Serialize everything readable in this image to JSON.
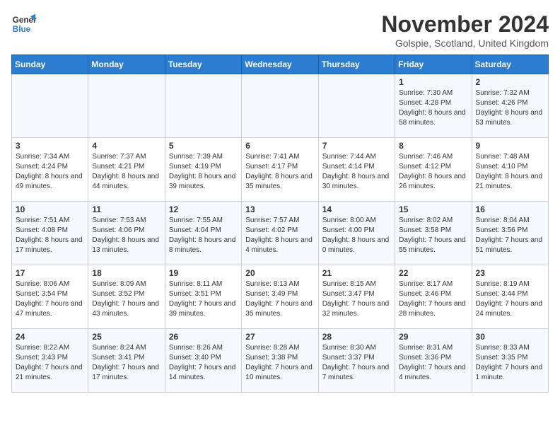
{
  "header": {
    "logo_line1": "General",
    "logo_line2": "Blue",
    "month_year": "November 2024",
    "location": "Golspie, Scotland, United Kingdom"
  },
  "days_of_week": [
    "Sunday",
    "Monday",
    "Tuesday",
    "Wednesday",
    "Thursday",
    "Friday",
    "Saturday"
  ],
  "weeks": [
    [
      {
        "day": "",
        "info": ""
      },
      {
        "day": "",
        "info": ""
      },
      {
        "day": "",
        "info": ""
      },
      {
        "day": "",
        "info": ""
      },
      {
        "day": "",
        "info": ""
      },
      {
        "day": "1",
        "info": "Sunrise: 7:30 AM\nSunset: 4:28 PM\nDaylight: 8 hours and 58 minutes."
      },
      {
        "day": "2",
        "info": "Sunrise: 7:32 AM\nSunset: 4:26 PM\nDaylight: 8 hours and 53 minutes."
      }
    ],
    [
      {
        "day": "3",
        "info": "Sunrise: 7:34 AM\nSunset: 4:24 PM\nDaylight: 8 hours and 49 minutes."
      },
      {
        "day": "4",
        "info": "Sunrise: 7:37 AM\nSunset: 4:21 PM\nDaylight: 8 hours and 44 minutes."
      },
      {
        "day": "5",
        "info": "Sunrise: 7:39 AM\nSunset: 4:19 PM\nDaylight: 8 hours and 39 minutes."
      },
      {
        "day": "6",
        "info": "Sunrise: 7:41 AM\nSunset: 4:17 PM\nDaylight: 8 hours and 35 minutes."
      },
      {
        "day": "7",
        "info": "Sunrise: 7:44 AM\nSunset: 4:14 PM\nDaylight: 8 hours and 30 minutes."
      },
      {
        "day": "8",
        "info": "Sunrise: 7:46 AM\nSunset: 4:12 PM\nDaylight: 8 hours and 26 minutes."
      },
      {
        "day": "9",
        "info": "Sunrise: 7:48 AM\nSunset: 4:10 PM\nDaylight: 8 hours and 21 minutes."
      }
    ],
    [
      {
        "day": "10",
        "info": "Sunrise: 7:51 AM\nSunset: 4:08 PM\nDaylight: 8 hours and 17 minutes."
      },
      {
        "day": "11",
        "info": "Sunrise: 7:53 AM\nSunset: 4:06 PM\nDaylight: 8 hours and 13 minutes."
      },
      {
        "day": "12",
        "info": "Sunrise: 7:55 AM\nSunset: 4:04 PM\nDaylight: 8 hours and 8 minutes."
      },
      {
        "day": "13",
        "info": "Sunrise: 7:57 AM\nSunset: 4:02 PM\nDaylight: 8 hours and 4 minutes."
      },
      {
        "day": "14",
        "info": "Sunrise: 8:00 AM\nSunset: 4:00 PM\nDaylight: 8 hours and 0 minutes."
      },
      {
        "day": "15",
        "info": "Sunrise: 8:02 AM\nSunset: 3:58 PM\nDaylight: 7 hours and 55 minutes."
      },
      {
        "day": "16",
        "info": "Sunrise: 8:04 AM\nSunset: 3:56 PM\nDaylight: 7 hours and 51 minutes."
      }
    ],
    [
      {
        "day": "17",
        "info": "Sunrise: 8:06 AM\nSunset: 3:54 PM\nDaylight: 7 hours and 47 minutes."
      },
      {
        "day": "18",
        "info": "Sunrise: 8:09 AM\nSunset: 3:52 PM\nDaylight: 7 hours and 43 minutes."
      },
      {
        "day": "19",
        "info": "Sunrise: 8:11 AM\nSunset: 3:51 PM\nDaylight: 7 hours and 39 minutes."
      },
      {
        "day": "20",
        "info": "Sunrise: 8:13 AM\nSunset: 3:49 PM\nDaylight: 7 hours and 35 minutes."
      },
      {
        "day": "21",
        "info": "Sunrise: 8:15 AM\nSunset: 3:47 PM\nDaylight: 7 hours and 32 minutes."
      },
      {
        "day": "22",
        "info": "Sunrise: 8:17 AM\nSunset: 3:46 PM\nDaylight: 7 hours and 28 minutes."
      },
      {
        "day": "23",
        "info": "Sunrise: 8:19 AM\nSunset: 3:44 PM\nDaylight: 7 hours and 24 minutes."
      }
    ],
    [
      {
        "day": "24",
        "info": "Sunrise: 8:22 AM\nSunset: 3:43 PM\nDaylight: 7 hours and 21 minutes."
      },
      {
        "day": "25",
        "info": "Sunrise: 8:24 AM\nSunset: 3:41 PM\nDaylight: 7 hours and 17 minutes."
      },
      {
        "day": "26",
        "info": "Sunrise: 8:26 AM\nSunset: 3:40 PM\nDaylight: 7 hours and 14 minutes."
      },
      {
        "day": "27",
        "info": "Sunrise: 8:28 AM\nSunset: 3:38 PM\nDaylight: 7 hours and 10 minutes."
      },
      {
        "day": "28",
        "info": "Sunrise: 8:30 AM\nSunset: 3:37 PM\nDaylight: 7 hours and 7 minutes."
      },
      {
        "day": "29",
        "info": "Sunrise: 8:31 AM\nSunset: 3:36 PM\nDaylight: 7 hours and 4 minutes."
      },
      {
        "day": "30",
        "info": "Sunrise: 8:33 AM\nSunset: 3:35 PM\nDaylight: 7 hours and 1 minute."
      }
    ]
  ]
}
